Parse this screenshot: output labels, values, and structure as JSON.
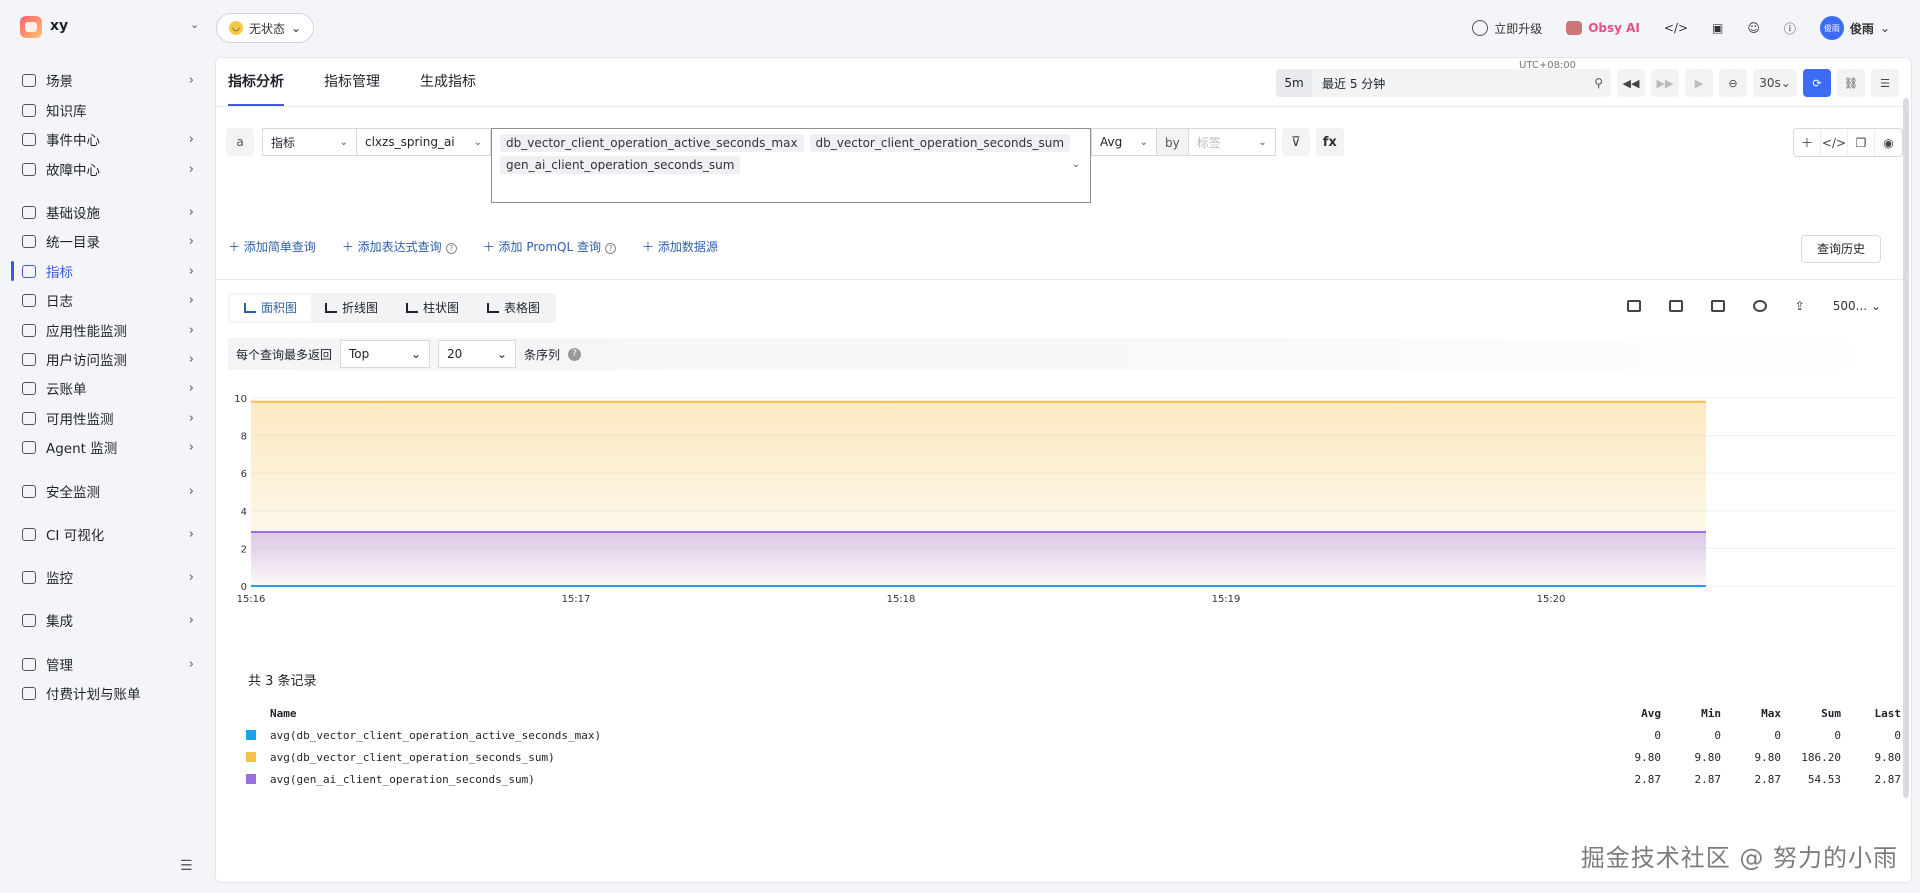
{
  "workspace": {
    "name": "xy",
    "status": "无状态"
  },
  "topbar": {
    "upgrade": "立即升级",
    "obsy": "Obsy AI",
    "avatar_text": "俊雨",
    "user": "俊雨"
  },
  "sidebar": {
    "items": [
      {
        "label": "场景",
        "chev": true
      },
      {
        "label": "知识库",
        "chev": false
      },
      {
        "label": "事件中心",
        "chev": true
      },
      {
        "label": "故障中心",
        "chev": true
      },
      {
        "label": "基础设施",
        "chev": true
      },
      {
        "label": "统一目录",
        "chev": true
      },
      {
        "label": "指标",
        "chev": true,
        "active": true
      },
      {
        "label": "日志",
        "chev": true
      },
      {
        "label": "应用性能监测",
        "chev": true
      },
      {
        "label": "用户访问监测",
        "chev": true
      },
      {
        "label": "云账单",
        "chev": true
      },
      {
        "label": "可用性监测",
        "chev": true
      },
      {
        "label": "Agent 监测",
        "chev": true
      },
      {
        "label": "安全监测",
        "chev": true
      },
      {
        "label": "CI 可视化",
        "chev": true
      },
      {
        "label": "监控",
        "chev": true
      },
      {
        "label": "集成",
        "chev": true
      },
      {
        "label": "管理",
        "chev": true
      },
      {
        "label": "付费计划与账单",
        "chev": false
      }
    ]
  },
  "tabs": [
    "指标分析",
    "指标管理",
    "生成指标"
  ],
  "time": {
    "short": "5m",
    "range": "最近 5 分钟",
    "tz": "UTC+08:00",
    "refresh": "30s"
  },
  "query": {
    "letter": "a",
    "type": "指标",
    "measurement": "clxzs_spring_ai",
    "metrics": [
      "db_vector_client_operation_active_seconds_max",
      "db_vector_client_operation_seconds_sum",
      "gen_ai_client_operation_seconds_sum"
    ],
    "agg": "Avg",
    "by": "by",
    "tag_placeholder": "标签",
    "fx": "fx"
  },
  "add_links": {
    "simple": "添加简单查询",
    "expr": "添加表达式查询",
    "promql": "添加 PromQL 查询",
    "source": "添加数据源"
  },
  "history_btn": "查询历史",
  "viz_tabs": [
    "面积图",
    "折线图",
    "柱状图",
    "表格图"
  ],
  "viz_right": {
    "limit": "500..."
  },
  "limit_row": {
    "label": "每个查询最多返回",
    "order": "Top",
    "count": "20",
    "suffix": "条序列"
  },
  "chart_data": {
    "type": "area",
    "x": [
      "15:16",
      "15:17",
      "15:18",
      "15:19",
      "15:20"
    ],
    "ylim": [
      0,
      10
    ],
    "yticks": [
      "0",
      "2",
      "4",
      "6",
      "8",
      "10"
    ],
    "series": [
      {
        "name": "avg(db_vector_client_operation_active_seconds_max)",
        "color": "#1aa3e8",
        "value": 0
      },
      {
        "name": "avg(db_vector_client_operation_seconds_sum)",
        "color": "#f5c14e",
        "value": 9.8
      },
      {
        "name": "avg(gen_ai_client_operation_seconds_sum)",
        "color": "#9b6fe0",
        "value": 2.87
      }
    ]
  },
  "legend": {
    "count_text": "共 3 条记录",
    "headers": [
      "Name",
      "Avg",
      "Min",
      "Max",
      "Sum",
      "Last"
    ],
    "rows": [
      {
        "name": "avg(db_vector_client_operation_active_seconds_max)",
        "color": "#1aa3e8",
        "vals": [
          "0",
          "0",
          "0",
          "0",
          "0"
        ]
      },
      {
        "name": "avg(db_vector_client_operation_seconds_sum)",
        "color": "#f5c14e",
        "vals": [
          "9.80",
          "9.80",
          "9.80",
          "186.20",
          "9.80"
        ]
      },
      {
        "name": "avg(gen_ai_client_operation_seconds_sum)",
        "color": "#9b6fe0",
        "vals": [
          "2.87",
          "2.87",
          "2.87",
          "54.53",
          "2.87"
        ]
      }
    ]
  },
  "watermark": "掘金技术社区 @ 努力的小雨"
}
